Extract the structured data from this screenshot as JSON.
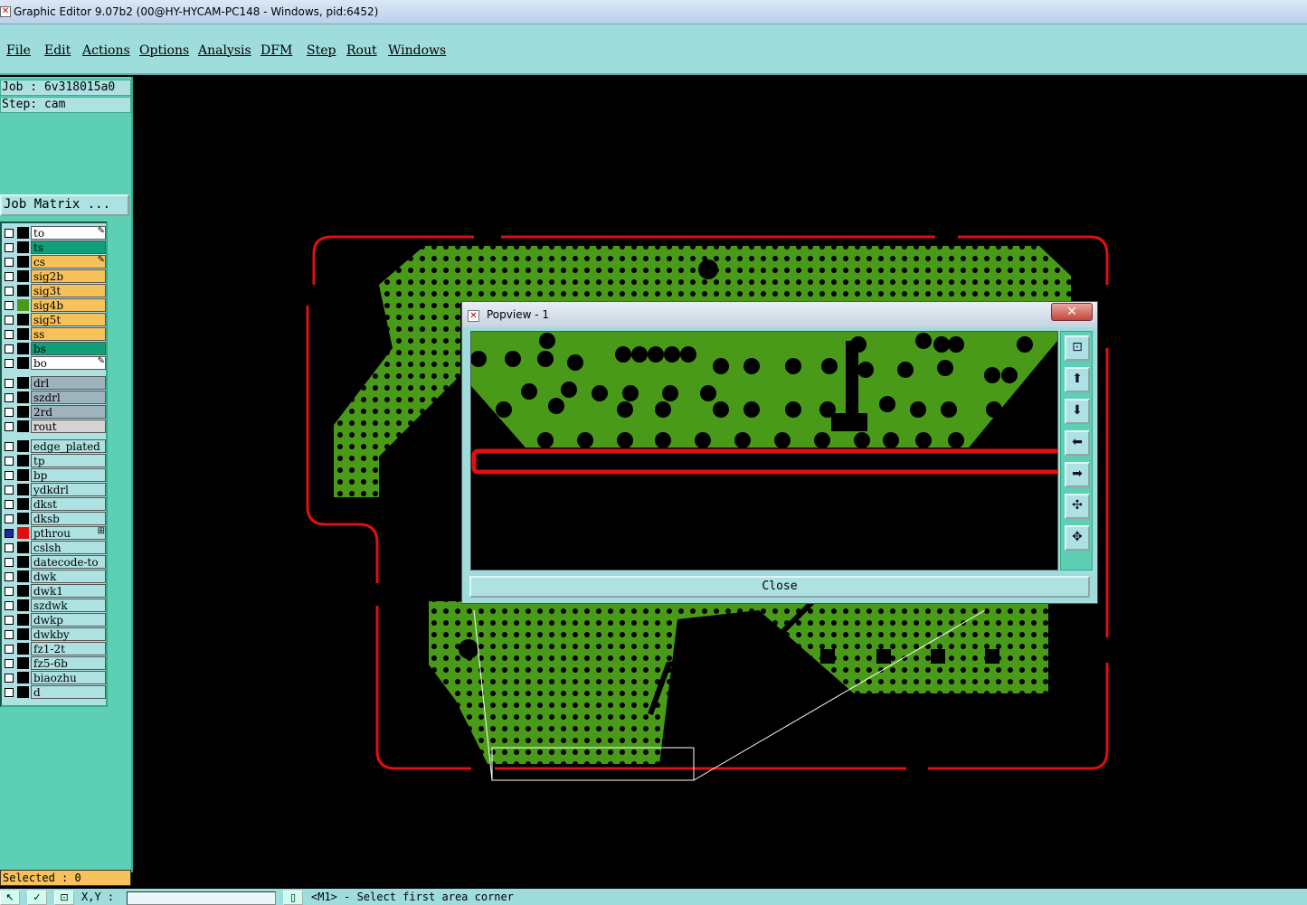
{
  "window": {
    "title": "Graphic Editor 9.07b2 (00@HY-HYCAM-PC148 - Windows, pid:6452)"
  },
  "menu": [
    {
      "label": "File"
    },
    {
      "label": "Edit"
    },
    {
      "label": "Actions"
    },
    {
      "label": "Options"
    },
    {
      "label": "Analysis"
    },
    {
      "label": "DFM"
    },
    {
      "label": "Step"
    },
    {
      "label": "Rout"
    },
    {
      "label": "Windows"
    }
  ],
  "panel": {
    "job": "Job : 6v318015a0",
    "step": "Step: cam",
    "job_matrix": "Job Matrix ...",
    "selected": "Selected : 0"
  },
  "layers": [
    {
      "name": "to",
      "bg": "#ffffff",
      "flag": "✎"
    },
    {
      "name": "ts",
      "bg": "#0fa07a"
    },
    {
      "name": "cs",
      "bg": "#f7c25a",
      "flag": "✎"
    },
    {
      "name": "sig2b",
      "bg": "#f7c25a"
    },
    {
      "name": "sig3t",
      "bg": "#f7c25a"
    },
    {
      "name": "sig4b",
      "bg": "#f7c25a",
      "swatch": "#4a9a1a"
    },
    {
      "name": "sig5t",
      "bg": "#f7c25a"
    },
    {
      "name": "ss",
      "bg": "#f7c25a"
    },
    {
      "name": "bs",
      "bg": "#0fa07a"
    },
    {
      "name": "bo",
      "bg": "#ffffff",
      "flag": "✎"
    },
    {
      "name": "drl",
      "bg": "#9fb3bf"
    },
    {
      "name": "szdrl",
      "bg": "#9fb3bf"
    },
    {
      "name": "2rd",
      "bg": "#9fb3bf"
    },
    {
      "name": "rout",
      "bg": "#d4d4d4"
    },
    {
      "name": "edge_plated",
      "bg": "#aee2e2"
    },
    {
      "name": "tp",
      "bg": "#aee2e2"
    },
    {
      "name": "bp",
      "bg": "#aee2e2"
    },
    {
      "name": "ydkdrl",
      "bg": "#aee2e2"
    },
    {
      "name": "dkst",
      "bg": "#aee2e2"
    },
    {
      "name": "dksb",
      "bg": "#aee2e2"
    },
    {
      "name": "pthrou",
      "bg": "#aee2e2",
      "swatch": "#e01010",
      "checked": true,
      "flag": "⊞"
    },
    {
      "name": "cslsh",
      "bg": "#aee2e2"
    },
    {
      "name": "datecode-to",
      "bg": "#aee2e2"
    },
    {
      "name": "dwk",
      "bg": "#aee2e2"
    },
    {
      "name": "dwk1",
      "bg": "#aee2e2"
    },
    {
      "name": "szdwk",
      "bg": "#aee2e2"
    },
    {
      "name": "dwkp",
      "bg": "#aee2e2"
    },
    {
      "name": "dwkby",
      "bg": "#aee2e2"
    },
    {
      "name": "fz1-2t",
      "bg": "#aee2e2"
    },
    {
      "name": "fz5-6b",
      "bg": "#aee2e2"
    },
    {
      "name": "biaozhu",
      "bg": "#aee2e2"
    },
    {
      "name": "d",
      "bg": "#aee2e2"
    }
  ],
  "popview": {
    "title": "Popview - 1",
    "close_label": "Close",
    "close_x": "✕",
    "tools": [
      {
        "icon": "zoom-window-icon",
        "glyph": "⊡"
      },
      {
        "icon": "pan-up-icon",
        "glyph": "⬆"
      },
      {
        "icon": "pan-down-icon",
        "glyph": "⬇"
      },
      {
        "icon": "pan-left-icon",
        "glyph": "⬅"
      },
      {
        "icon": "pan-right-icon",
        "glyph": "➡"
      },
      {
        "icon": "zoom-in-icon",
        "glyph": "✣"
      },
      {
        "icon": "zoom-out-icon",
        "glyph": "✥"
      }
    ]
  },
  "status": {
    "xy_label": "X,Y :",
    "prompt": "<M1> - Select first area corner"
  },
  "colors": {
    "copper": "#4a9a1a",
    "outline": "#e01010",
    "panel": "#5ccfb5",
    "menu": "#9fdcdc"
  }
}
